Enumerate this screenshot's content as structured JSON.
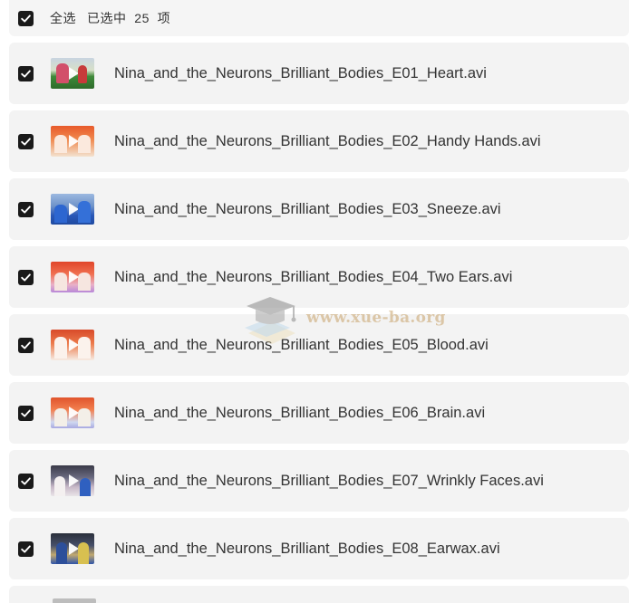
{
  "header": {
    "select_all_label": "全选",
    "selected_text": "已选中  25  项"
  },
  "icons": {
    "checkbox": "checkbox-checked-icon",
    "video_thumbnail": "video-thumbnail",
    "play": "play-icon"
  },
  "colors": {
    "checkbox_fill": "#1a1a1a",
    "row_background": "#f3f3f3",
    "text": "#333333"
  },
  "files": [
    {
      "name": "Nina_and_the_Neurons_Brilliant_Bodies_E01_Heart.avi",
      "checked": true
    },
    {
      "name": "Nina_and_the_Neurons_Brilliant_Bodies_E02_Handy Hands.avi",
      "checked": true
    },
    {
      "name": "Nina_and_the_Neurons_Brilliant_Bodies_E03_Sneeze.avi",
      "checked": true
    },
    {
      "name": "Nina_and_the_Neurons_Brilliant_Bodies_E04_Two Ears.avi",
      "checked": true
    },
    {
      "name": "Nina_and_the_Neurons_Brilliant_Bodies_E05_Blood.avi",
      "checked": true
    },
    {
      "name": "Nina_and_the_Neurons_Brilliant_Bodies_E06_Brain.avi",
      "checked": true
    },
    {
      "name": "Nina_and_the_Neurons_Brilliant_Bodies_E07_Wrinkly Faces.avi",
      "checked": true
    },
    {
      "name": "Nina_and_the_Neurons_Brilliant_Bodies_E08_Earwax.avi",
      "checked": true
    }
  ],
  "watermark": {
    "text": "www.xue-ba.org"
  }
}
